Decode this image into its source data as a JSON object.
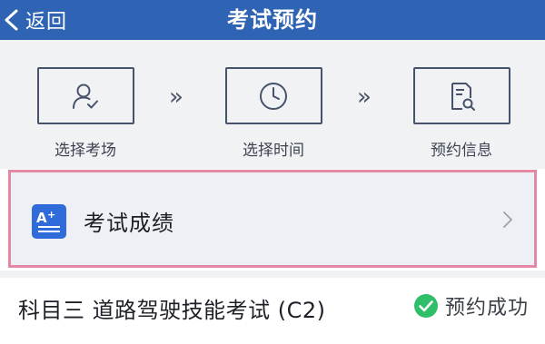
{
  "nav": {
    "back_label": "返回",
    "title": "考试预约",
    "background": "#2f63b3"
  },
  "steps": [
    {
      "label": "选择考场",
      "icon": "user-check-icon"
    },
    {
      "label": "选择时间",
      "icon": "clock-icon"
    },
    {
      "label": "预约信息",
      "icon": "document-search-icon"
    }
  ],
  "step_separator": "»",
  "score_row": {
    "label": "考试成绩",
    "icon": "score-icon",
    "highlight_color": "#e389a5"
  },
  "exam": {
    "name": "科目三 道路驾驶技能考试 (C2)",
    "status": "预约成功",
    "status_color": "#2fbf6b"
  }
}
